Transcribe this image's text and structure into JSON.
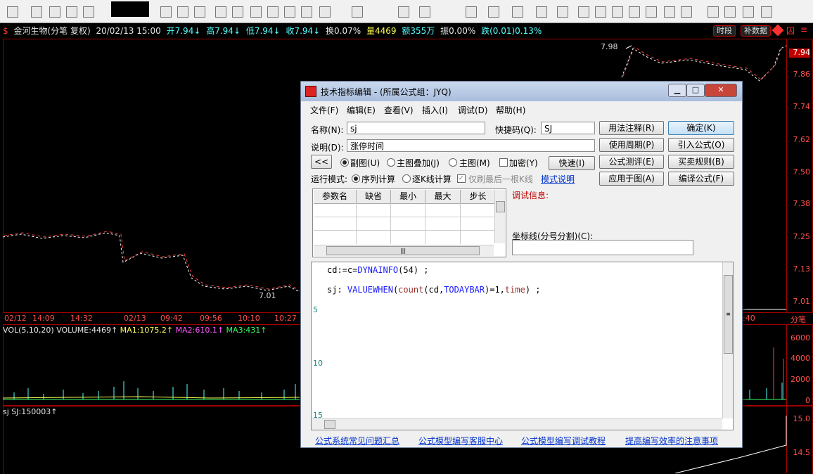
{
  "infobar": {
    "name": "金河生物(分笔 复权)",
    "date": "20/02/13 15:00",
    "open": "开7.94↓",
    "high": "高7.94↓",
    "low": "低7.94↓",
    "close": "收7.94↓",
    "turnover": "换0.07%",
    "volume": "量4469",
    "amount": "额355万",
    "amplitude": "振0.00%",
    "change": "跌(0.01)0.13%",
    "tag_time": "时段",
    "tag_data": "补数据"
  },
  "price_axis": [
    "7.94",
    "7.86",
    "7.74",
    "7.62",
    "7.50",
    "7.38",
    "7.25",
    "7.13",
    "7.01"
  ],
  "price_marks": {
    "high": "7.98",
    "low": "7.01"
  },
  "timebar": {
    "labels": [
      "02/12",
      "14:09",
      "14:32",
      "02/13",
      "09:42",
      "09:56",
      "10:10",
      "10:27",
      ":40"
    ],
    "right_label": "分笔"
  },
  "vol_indicator": {
    "name": "VOL(5,10,20)",
    "volume": "VOLUME:4469↑",
    "ma1": "MA1:1075.2↑",
    "ma2": "MA2:610.1↑",
    "ma3": "MA3:431↑"
  },
  "vol_axis": [
    "6000",
    "4000",
    "2000",
    "0"
  ],
  "sj_indicator": {
    "label": "sj  SJ:150003↑"
  },
  "sj_axis": [
    "15.0",
    "14.5"
  ],
  "dialog": {
    "title": "技术指标编辑 - (所属公式组：JYQ)",
    "menu": [
      "文件(F)",
      "编辑(E)",
      "查看(V)",
      "插入(I)",
      "调试(D)",
      "帮助(H)"
    ],
    "name_label": "名称(N):",
    "name_value": "sj",
    "shortcut_label": "快捷码(Q):",
    "shortcut_value": "SJ",
    "desc_label": "说明(D):",
    "desc_value": "涨停时间",
    "collapse_button": "<<",
    "radio_sub": "副图(U)",
    "radio_overlay": "主图叠加(J)",
    "radio_main": "主图(M)",
    "encrypt": "加密(Y)",
    "quick_button": "快速(I)",
    "run_mode_label": "运行模式:",
    "run_seq": "序列计算",
    "run_tick": "逐K线计算",
    "refresh_last": "仅刷最后一根K线",
    "mode_link": "模式说明",
    "buttons_right": [
      "用法注释(R)",
      "确定(K)",
      "使用周期(P)",
      "引入公式(O)",
      "公式测评(E)",
      "买卖规则(B)",
      "应用于图(A)",
      "编译公式(F)"
    ],
    "param_headers": [
      "参数名",
      "缺省",
      "最小",
      "最大",
      "步长"
    ],
    "debug_label": "调试信息:",
    "axis_label": "坐标线(分号分割)(C):",
    "line_numbers": [
      "5",
      "10",
      "15"
    ],
    "code_line1_a": "cd:=c=",
    "code_line1_fn": "DYNAINFO",
    "code_line1_b": "(54) ;",
    "code_line2_a": "sj: ",
    "code_line2_fn1": "VALUEWHEN",
    "code_line2_b": "(",
    "code_line2_fn2": "count",
    "code_line2_c": "(cd,",
    "code_line2_fn3": "TODAYBAR",
    "code_line2_d": ")=1,",
    "code_line2_fn4": "time",
    "code_line2_e": ") ;",
    "footer_links": [
      "公式系统常见问题汇总",
      "公式模型编写客服中心",
      "公式模型编写调试教程",
      "提高编写效率的注意事项"
    ]
  }
}
